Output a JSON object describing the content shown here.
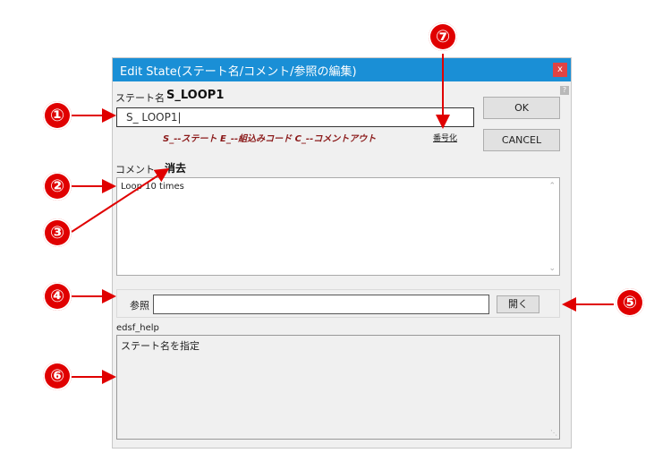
{
  "dialog": {
    "title": "Edit State(ステート名/コメント/参照の編集)",
    "close_glyph": "x",
    "help_glyph": "?",
    "state_name_label": "ステート名",
    "state_name_value": "S_LOOP1",
    "state_name_input": "S_ LOOP1",
    "hint_text": "S_--ステート E_--組込みコード C_--コメントアウト",
    "numbering_label": "番号化",
    "ok_label": "OK",
    "cancel_label": "CANCEL",
    "comment_label": "コメント",
    "clear_label": "消去",
    "comment_text": "Loop 10 times",
    "reference_label": "参照",
    "reference_value": "",
    "open_label": "開く",
    "help_title": "edsf_help",
    "help_text": "ステート名を指定"
  },
  "markers": [
    "①",
    "②",
    "③",
    "④",
    "⑤",
    "⑥",
    "⑦"
  ],
  "colors": {
    "titlebar": "#1a8fd6",
    "annotation": "#e00000"
  }
}
